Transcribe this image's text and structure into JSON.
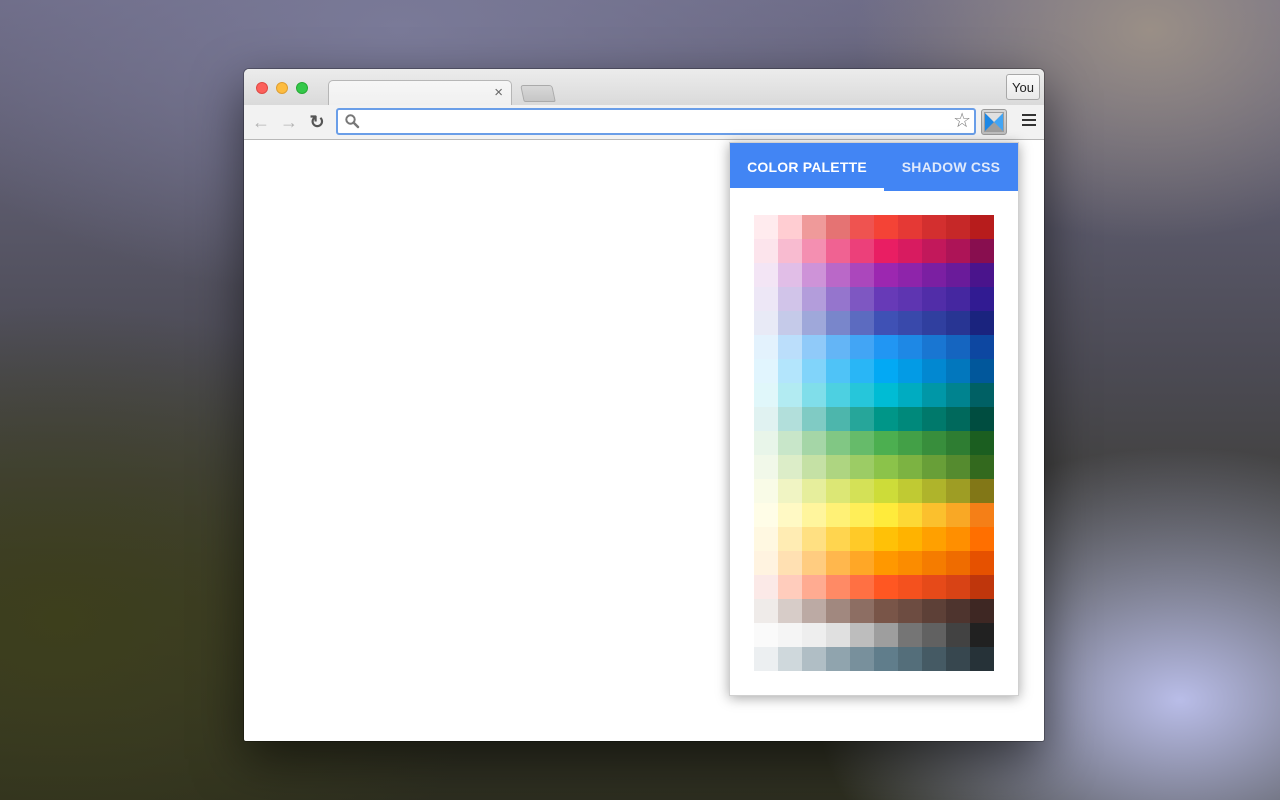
{
  "browser": {
    "profile_label": "You",
    "tab_close": "×",
    "address_value": "",
    "star_glyph": "☆",
    "back_glyph": "←",
    "forward_glyph": "→",
    "reload_glyph": "↻"
  },
  "popup": {
    "tab_active": "COLOR PALETTE",
    "tab_inactive": "SHADOW CSS",
    "accent": "#4285f4"
  },
  "palette": [
    [
      "#ffebee",
      "#ffcdd2",
      "#ef9a9a",
      "#e57373",
      "#ef5350",
      "#f44336",
      "#e53935",
      "#d32f2f",
      "#c62828",
      "#b71c1c"
    ],
    [
      "#fce4ec",
      "#f8bbd0",
      "#f48fb1",
      "#f06292",
      "#ec407a",
      "#e91e63",
      "#d81b60",
      "#c2185b",
      "#ad1457",
      "#880e4f"
    ],
    [
      "#f3e5f5",
      "#e1bee7",
      "#ce93d8",
      "#ba68c8",
      "#ab47bc",
      "#9c27b0",
      "#8e24aa",
      "#7b1fa2",
      "#6a1b9a",
      "#4a148c"
    ],
    [
      "#ede7f6",
      "#d1c4e9",
      "#b39ddb",
      "#9575cd",
      "#7e57c2",
      "#673ab7",
      "#5e35b1",
      "#512da8",
      "#4527a0",
      "#311b92"
    ],
    [
      "#e8eaf6",
      "#c5cae9",
      "#9fa8da",
      "#7986cb",
      "#5c6bc0",
      "#3f51b5",
      "#3949ab",
      "#303f9f",
      "#283593",
      "#1a237e"
    ],
    [
      "#e3f2fd",
      "#bbdefb",
      "#90caf9",
      "#64b5f6",
      "#42a5f5",
      "#2196f3",
      "#1e88e5",
      "#1976d2",
      "#1565c0",
      "#0d47a1"
    ],
    [
      "#e1f5fe",
      "#b3e5fc",
      "#81d4fa",
      "#4fc3f7",
      "#29b6f6",
      "#03a9f4",
      "#039be5",
      "#0288d1",
      "#0277bd",
      "#01579b"
    ],
    [
      "#e0f7fa",
      "#b2ebf2",
      "#80deea",
      "#4dd0e1",
      "#26c6da",
      "#00bcd4",
      "#00acc1",
      "#0097a7",
      "#00838f",
      "#006064"
    ],
    [
      "#e0f2f1",
      "#b2dfdb",
      "#80cbc4",
      "#4db6ac",
      "#26a69a",
      "#009688",
      "#00897b",
      "#00796b",
      "#00695c",
      "#004d40"
    ],
    [
      "#e8f5e9",
      "#c8e6c9",
      "#a5d6a7",
      "#81c784",
      "#66bb6a",
      "#4caf50",
      "#43a047",
      "#388e3c",
      "#2e7d32",
      "#1b5e20"
    ],
    [
      "#f1f8e9",
      "#dcedc8",
      "#c5e1a5",
      "#aed581",
      "#9ccc65",
      "#8bc34a",
      "#7cb342",
      "#689f38",
      "#558b2f",
      "#33691e"
    ],
    [
      "#f9fbe7",
      "#f0f4c3",
      "#e6ee9c",
      "#dce775",
      "#d4e157",
      "#cddc39",
      "#c0ca33",
      "#afb42b",
      "#9e9d24",
      "#827717"
    ],
    [
      "#fffde7",
      "#fff9c4",
      "#fff59d",
      "#fff176",
      "#ffee58",
      "#ffeb3b",
      "#fdd835",
      "#fbc02d",
      "#f9a825",
      "#f57f17"
    ],
    [
      "#fff8e1",
      "#ffecb3",
      "#ffe082",
      "#ffd54f",
      "#ffca28",
      "#ffc107",
      "#ffb300",
      "#ffa000",
      "#ff8f00",
      "#ff6f00"
    ],
    [
      "#fff3e0",
      "#ffe0b2",
      "#ffcc80",
      "#ffb74d",
      "#ffa726",
      "#ff9800",
      "#fb8c00",
      "#f57c00",
      "#ef6c00",
      "#e65100"
    ],
    [
      "#fbe9e7",
      "#ffccbc",
      "#ffab91",
      "#ff8a65",
      "#ff7043",
      "#ff5722",
      "#f4511e",
      "#e64a19",
      "#d84315",
      "#bf360c"
    ],
    [
      "#efebe9",
      "#d7ccc8",
      "#bcaaa4",
      "#a1887f",
      "#8d6e63",
      "#795548",
      "#6d4c41",
      "#5d4037",
      "#4e342e",
      "#3e2723"
    ],
    [
      "#fafafa",
      "#f5f5f5",
      "#eeeeee",
      "#e0e0e0",
      "#bdbdbd",
      "#9e9e9e",
      "#757575",
      "#616161",
      "#424242",
      "#212121"
    ],
    [
      "#eceff1",
      "#cfd8dc",
      "#b0bec5",
      "#90a4ae",
      "#78909c",
      "#607d8b",
      "#546e7a",
      "#455a64",
      "#37474f",
      "#263238"
    ]
  ]
}
